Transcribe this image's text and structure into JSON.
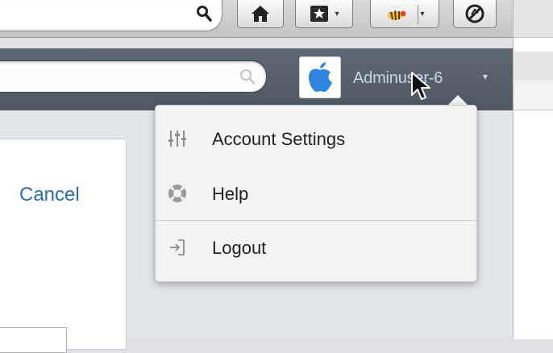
{
  "toolbar": {
    "buttons": [
      {
        "name": "search",
        "icon": "magnifier-icon"
      },
      {
        "name": "home",
        "icon": "home-icon"
      },
      {
        "name": "bookmarks",
        "icon": "bookmark-star-icon"
      },
      {
        "name": "extension",
        "icon": "bee-icon"
      },
      {
        "name": "addon",
        "icon": "no-script-icon"
      }
    ]
  },
  "header": {
    "search_placeholder": "",
    "user_name": "Adminuser-6",
    "avatar_icon": "apple-logo-icon",
    "caret": "▾"
  },
  "content": {
    "cancel_label": "Cancel"
  },
  "menu": {
    "items": [
      {
        "label": "Account Settings",
        "icon": "sliders-icon"
      },
      {
        "label": "Help",
        "icon": "lifebuoy-icon"
      },
      {
        "label": "Logout",
        "icon": "logout-icon"
      }
    ]
  },
  "colors": {
    "header_bg": "#565f69",
    "user_name": "#c9d6e6",
    "link": "#2a6db0",
    "menu_bg": "#f3f3f3",
    "apple_logo": "#2e86e0"
  }
}
